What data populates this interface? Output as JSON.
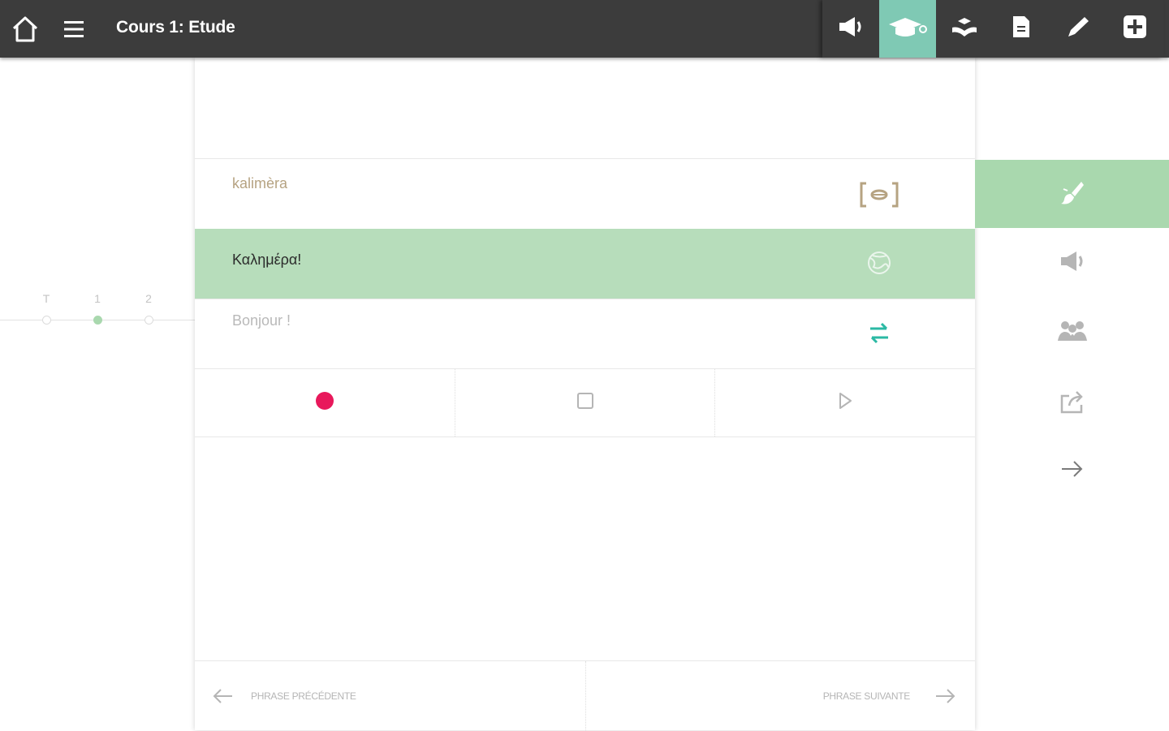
{
  "header": {
    "title": "Cours 1: Etude",
    "home_icon": "home-icon",
    "menu_icon": "hamburger-menu-icon"
  },
  "toolbar": {
    "items": [
      {
        "icon": "speaker-icon",
        "active": false
      },
      {
        "icon": "graduation-cap-icon",
        "active": true
      },
      {
        "icon": "hand-book-icon",
        "active": false
      },
      {
        "icon": "document-icon",
        "active": false
      },
      {
        "icon": "pencil-icon",
        "active": false
      },
      {
        "icon": "add-icon",
        "active": false
      }
    ],
    "active_color": "#7fc9b4"
  },
  "timeline": {
    "labels": [
      "T",
      "1",
      "2"
    ],
    "active_index": 1
  },
  "lesson": {
    "phonetic": "kalimèra",
    "original": "Καλημέρα!",
    "translation": "Bonjour !",
    "phonetic_icon": "phonetic-brackets-icon",
    "original_icon": "language-globe-icon",
    "translation_icon": "swap-arrows-icon"
  },
  "recorder": {
    "record_icon": "record-icon",
    "stop_icon": "stop-icon",
    "play_icon": "play-icon",
    "record_color": "#e8185b"
  },
  "navigation": {
    "previous_label": "PHRASE PRÉCÉDENTE",
    "next_label": "PHRASE SUIVANTE"
  },
  "sidebar": {
    "items": [
      {
        "icon": "brush-icon",
        "active": true
      },
      {
        "icon": "speaker-icon",
        "active": false
      },
      {
        "icon": "group-icon",
        "active": false
      },
      {
        "icon": "share-icon",
        "active": false
      },
      {
        "icon": "arrow-right-icon",
        "active": false
      }
    ],
    "active_color": "#a9d8ae"
  }
}
